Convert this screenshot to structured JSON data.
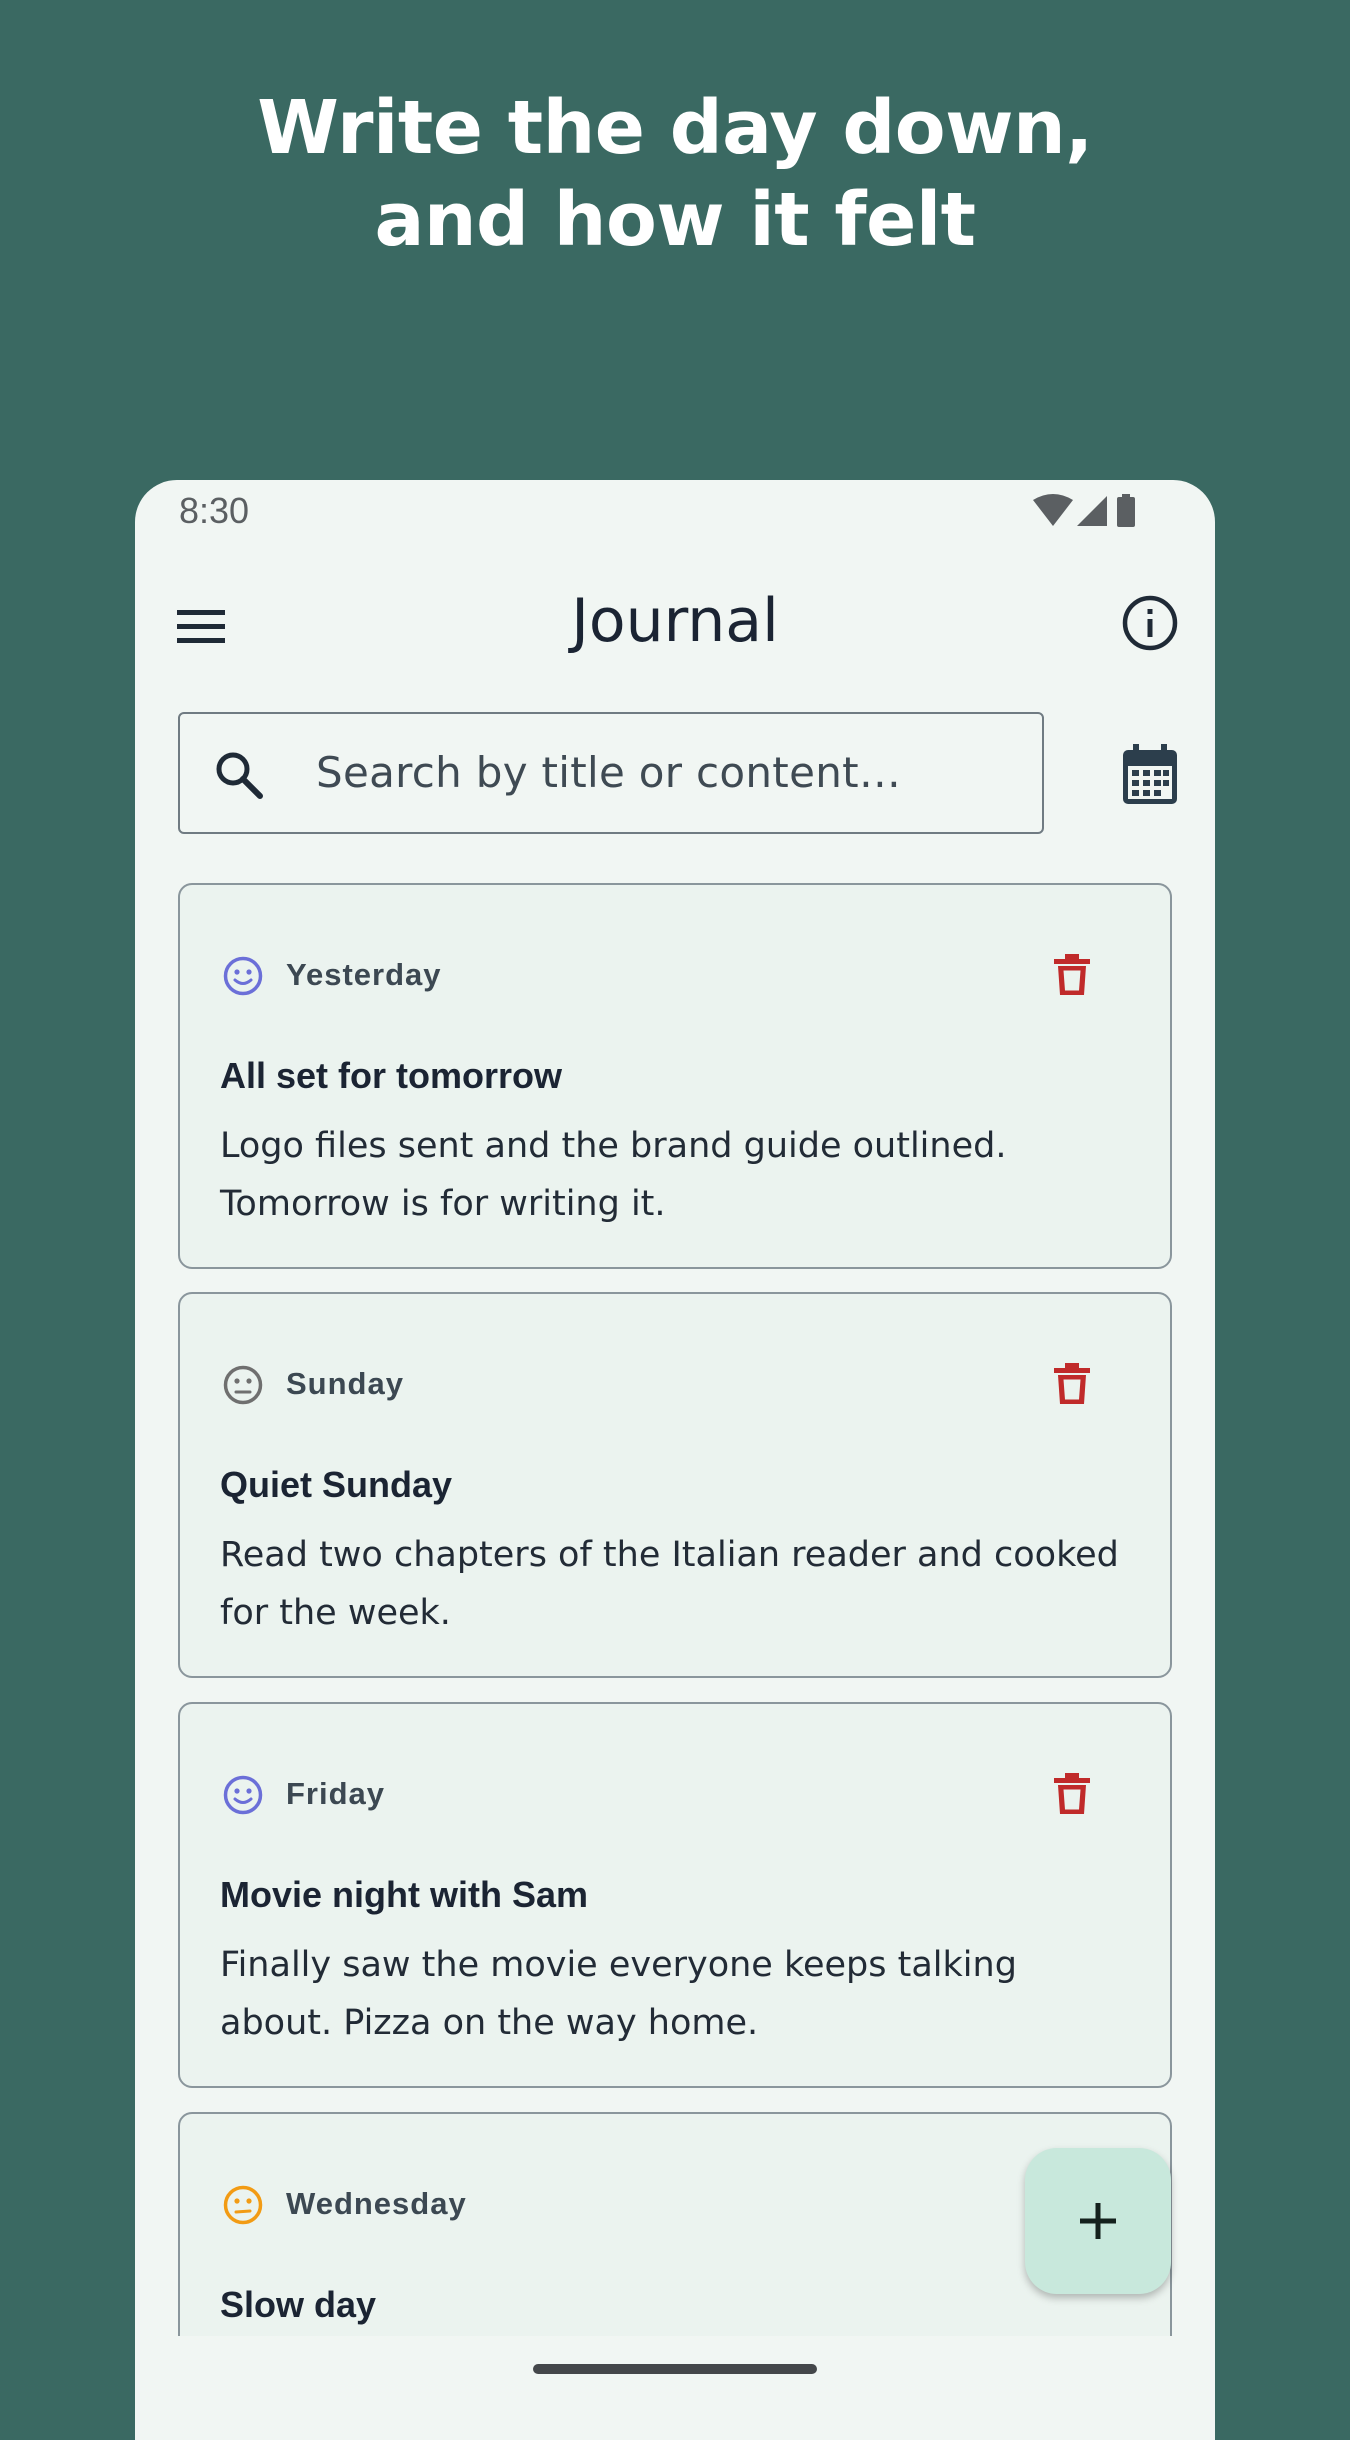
{
  "headline": {
    "line1": "Write the day down,",
    "line2": "and how it felt"
  },
  "status_bar": {
    "time": "8:30",
    "icons": [
      "wifi-icon",
      "signal-icon",
      "battery-icon"
    ]
  },
  "app_bar": {
    "title": "Journal",
    "left_icon": "menu-icon",
    "right_icon": "info-icon"
  },
  "search": {
    "placeholder": "Search by title or content…",
    "icon": "search-icon",
    "calendar_icon": "calendar-icon"
  },
  "entries": [
    {
      "mood": "happy",
      "mood_color": "#6b6fd8",
      "date": "Yesterday",
      "title": "All set for tomorrow",
      "body": "Logo files sent and the brand guide outlined. Tomorrow is for writing it."
    },
    {
      "mood": "neutral",
      "mood_color": "#6f6f6f",
      "date": "Sunday",
      "title": "Quiet Sunday",
      "body": "Read two chapters of the Italian reader and cooked for the week."
    },
    {
      "mood": "happy",
      "mood_color": "#6b6fd8",
      "date": "Friday",
      "title": "Movie night with Sam",
      "body": "Finally saw the movie everyone keeps talking about. Pizza on the way home."
    },
    {
      "mood": "meh",
      "mood_color": "#f29b14",
      "date": "Wednesday",
      "title": "Slow day",
      "body": ""
    }
  ],
  "colors": {
    "background": "#3a6962",
    "surface": "#f1f6f3",
    "card": "#ebf3ef",
    "delete": "#c02a2a",
    "fab": "#c8e8dc"
  },
  "fab": {
    "icon": "plus-icon"
  }
}
